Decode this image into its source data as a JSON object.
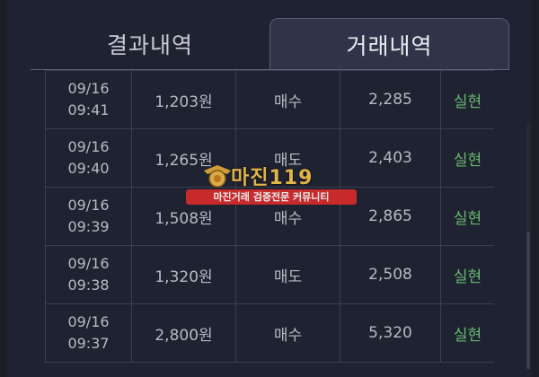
{
  "tabs": [
    {
      "label": "결과내역",
      "active": false
    },
    {
      "label": "거래내역",
      "active": true
    }
  ],
  "rows": [
    {
      "date": "09/16",
      "time": "09:41",
      "price": "1,203원",
      "type": "매수",
      "amount": "2,285",
      "status": "실현"
    },
    {
      "date": "09/16",
      "time": "09:40",
      "price": "1,265원",
      "type": "매도",
      "amount": "2,403",
      "status": "실현"
    },
    {
      "date": "09/16",
      "time": "09:39",
      "price": "1,508원",
      "type": "매수",
      "amount": "2,865",
      "status": "실현"
    },
    {
      "date": "09/16",
      "time": "09:38",
      "price": "1,320원",
      "type": "매도",
      "amount": "2,508",
      "status": "실현"
    },
    {
      "date": "09/16",
      "time": "09:37",
      "price": "2,800원",
      "type": "매수",
      "amount": "5,320",
      "status": "실현"
    }
  ],
  "watermark": {
    "title": "마진119",
    "banner": "마진거래 검증전문 커뮤니티"
  },
  "colors": {
    "status": "#67b96f",
    "background": "#1f2230",
    "active_tab": "#2f3448"
  }
}
